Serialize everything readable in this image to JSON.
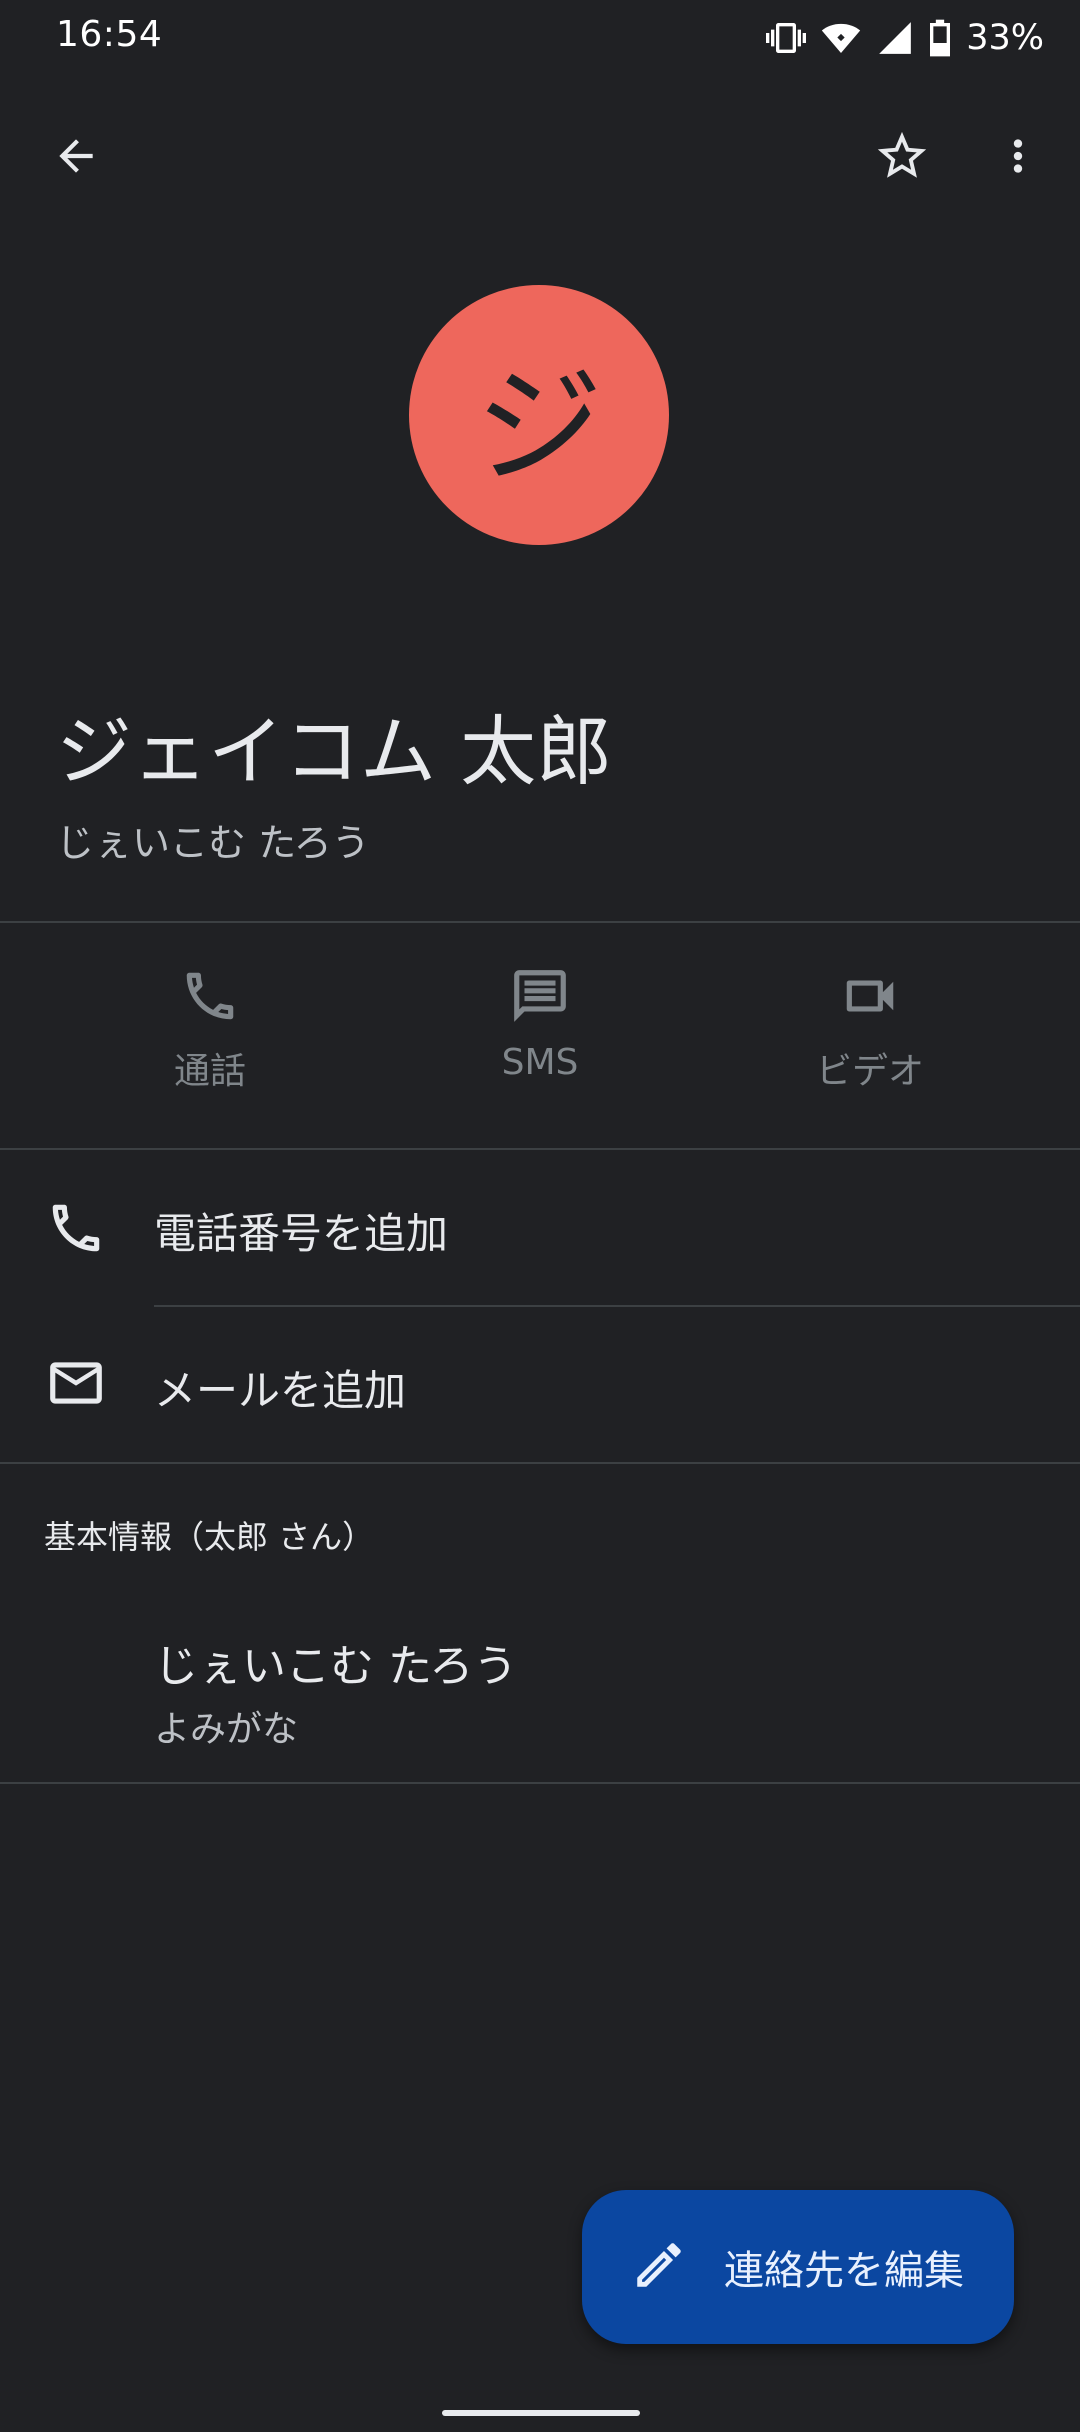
{
  "status_bar": {
    "time": "16:54",
    "battery_text": "33%"
  },
  "top_bar": {
    "back_icon": "arrow-back-icon",
    "favorite_icon": "star-outline-icon",
    "more_icon": "more-vert-icon"
  },
  "contact": {
    "avatar_initial": "ジ",
    "avatar_color": "#ee675c",
    "name": "ジェイコム 太郎",
    "name_reading": "じぇいこむ たろう"
  },
  "actions": [
    {
      "label": "通話",
      "icon": "phone-icon"
    },
    {
      "label": "SMS",
      "icon": "message-icon"
    },
    {
      "label": "ビデオ",
      "icon": "videocam-icon"
    }
  ],
  "rows": {
    "add_phone": {
      "label": "電話番号を追加",
      "icon": "phone-icon"
    },
    "add_email": {
      "label": "メールを追加",
      "icon": "mail-icon"
    }
  },
  "about": {
    "section_title": "基本情報（太郎 さん）",
    "reading_value": "じぇいこむ たろう",
    "reading_label": "よみがな"
  },
  "fab": {
    "label": "連絡先を編集",
    "icon": "edit-pencil-icon",
    "color": "#0b47a1"
  }
}
